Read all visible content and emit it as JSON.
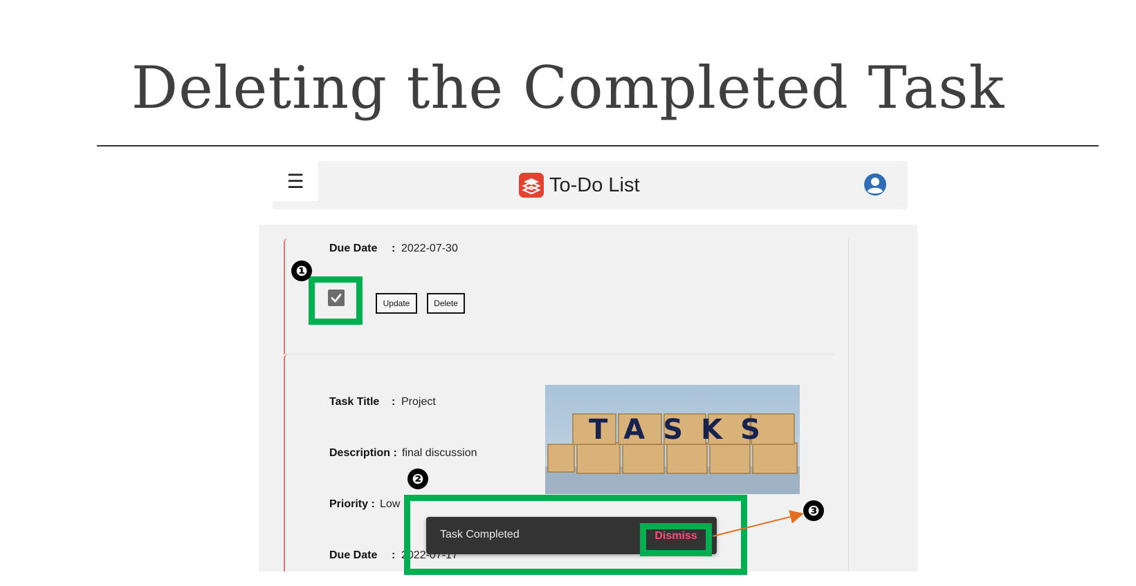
{
  "slide": {
    "title": "Deleting the Completed Task"
  },
  "header": {
    "menu_icon": "hamburger-icon",
    "logo_icon": "todoist-logo-icon",
    "app_title": "To-Do List",
    "profile_icon": "user-account-icon"
  },
  "task1": {
    "due_date_label": "Due Date",
    "colon": ":",
    "due_date_value": "2022-07-30",
    "completed": true,
    "update_label": "Update",
    "delete_label": "Delete"
  },
  "task2": {
    "title_label": "Task Title",
    "title_value": "Project",
    "description_label": "Description :",
    "description_value": "final discussion",
    "priority_label": "Priority :",
    "priority_value": "Low",
    "due_date_label": "Due Date",
    "colon": ":",
    "due_date_value": "2022-07-17",
    "image_text": "TASKS"
  },
  "snackbar": {
    "message": "Task Completed",
    "action_label": "Dismiss"
  },
  "annotations": {
    "step1": "❶",
    "step2": "❷",
    "step3": "❸",
    "highlight_color": "#00b050",
    "arrow_color": "#e07020"
  },
  "colors": {
    "accent_red": "#e57373",
    "dismiss_pink": "#f0507a",
    "snackbar_bg": "#333333"
  }
}
